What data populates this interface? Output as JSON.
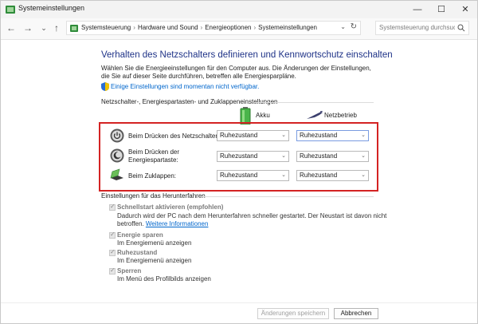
{
  "window": {
    "title": "Systemeinstellungen",
    "minimize": "—",
    "maximize": "☐",
    "close": "✕"
  },
  "nav": {
    "back": "←",
    "forward": "→",
    "dropdown": "⌄",
    "up": "↑",
    "breadcrumbs": [
      "Systemsteuerung",
      "Hardware und Sound",
      "Energieoptionen",
      "Systemeinstellungen"
    ],
    "separator": "›",
    "address_dropdown": "⌄",
    "refresh": "↻",
    "search_placeholder": "Systemsteuerung durchsuch..."
  },
  "content": {
    "heading": "Verhalten des Netzschalters definieren und Kennwortschutz einschalten",
    "description": "Wählen Sie die Energieeinstellungen für den Computer aus. Die Änderungen der Einstellungen, die Sie auf dieser Seite durchführen, betreffen alle Energiesparpläne.",
    "admin_link": "Einige Einstellungen sind momentan nicht verfügbar.",
    "section_buttons": "Netzschalter-, Energiespartasten- und Zuklappeneinstellungen",
    "col_battery": "Akku",
    "col_ac": "Netzbetrieb",
    "rows": [
      {
        "label": "Beim Drücken des Netzschalters:",
        "battery": "Ruhezustand",
        "ac": "Ruhezustand"
      },
      {
        "label": "Beim Drücken der Energiespartaste:",
        "battery": "Ruhezustand",
        "ac": "Ruhezustand"
      },
      {
        "label": "Beim Zuklappen:",
        "battery": "Ruhezustand",
        "ac": "Ruhezustand"
      }
    ],
    "dropdown_arrow": "⌄",
    "section_shutdown": "Einstellungen für das Herunterfahren",
    "shutdown": [
      {
        "label": "Schnellstart aktivieren (empfohlen)",
        "desc": "Dadurch wird der PC nach dem Herunterfahren schneller gestartet. Der Neustart ist davon nicht betroffen.",
        "link": "Weitere Informationen",
        "checked": true
      },
      {
        "label": "Energie sparen",
        "desc": "Im Energiemenü anzeigen",
        "checked": true
      },
      {
        "label": "Ruhezustand",
        "desc": "Im Energiemenü anzeigen",
        "checked": true
      },
      {
        "label": "Sperren",
        "desc": "Im Menü des Profilbilds anzeigen",
        "checked": true
      }
    ],
    "check_glyph": "✓"
  },
  "footer": {
    "save": "Änderungen speichern",
    "cancel": "Abbrechen"
  },
  "colors": {
    "heading": "#1e3287",
    "link": "#0066cc",
    "highlight": "#d42323"
  }
}
